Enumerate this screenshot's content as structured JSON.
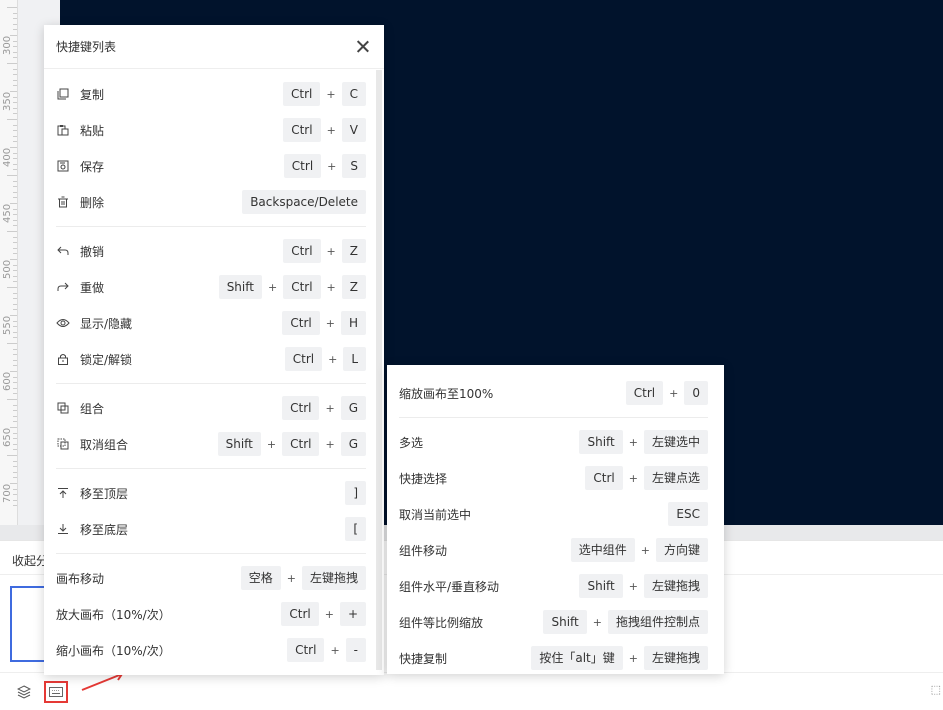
{
  "ruler": {
    "ticks": [
      "300",
      "350",
      "400",
      "450",
      "500",
      "550",
      "600",
      "650",
      "700"
    ]
  },
  "bottom_panel": {
    "tab_label": "收起分"
  },
  "shortcut_panel": {
    "title": "快捷键列表",
    "groups": [
      [
        {
          "icon": "copy-icon",
          "label": "复制",
          "keys": [
            "Ctrl",
            "C"
          ]
        },
        {
          "icon": "paste-icon",
          "label": "粘贴",
          "keys": [
            "Ctrl",
            "V"
          ]
        },
        {
          "icon": "save-icon",
          "label": "保存",
          "keys": [
            "Ctrl",
            "S"
          ]
        },
        {
          "icon": "delete-icon",
          "label": "删除",
          "keys": [
            "Backspace/Delete"
          ]
        }
      ],
      [
        {
          "icon": "undo-icon",
          "label": "撤销",
          "keys": [
            "Ctrl",
            "Z"
          ]
        },
        {
          "icon": "redo-icon",
          "label": "重做",
          "keys": [
            "Shift",
            "Ctrl",
            "Z"
          ]
        },
        {
          "icon": "eye-icon",
          "label": "显示/隐藏",
          "keys": [
            "Ctrl",
            "H"
          ]
        },
        {
          "icon": "lock-icon",
          "label": "锁定/解锁",
          "keys": [
            "Ctrl",
            "L"
          ]
        }
      ],
      [
        {
          "icon": "group-icon",
          "label": "组合",
          "keys": [
            "Ctrl",
            "G"
          ]
        },
        {
          "icon": "ungroup-icon",
          "label": "取消组合",
          "keys": [
            "Shift",
            "Ctrl",
            "G"
          ]
        }
      ],
      [
        {
          "icon": "move-top-icon",
          "label": "移至顶层",
          "keys": [
            "]"
          ]
        },
        {
          "icon": "move-bottom-icon",
          "label": "移至底层",
          "keys": [
            "["
          ]
        }
      ],
      [
        {
          "icon": "",
          "label": "画布移动",
          "keys": [
            "空格",
            "左键拖拽"
          ]
        },
        {
          "icon": "",
          "label": "放大画布（10%/次）",
          "keys": [
            "Ctrl",
            "+"
          ]
        },
        {
          "icon": "",
          "label": "缩小画布（10%/次）",
          "keys": [
            "Ctrl",
            "-"
          ]
        }
      ]
    ]
  },
  "shortcut_panel_2": {
    "groups": [
      [
        {
          "label": "缩放画布至100%",
          "keys": [
            "Ctrl",
            "0"
          ]
        }
      ],
      [
        {
          "label": "多选",
          "keys": [
            "Shift",
            "左键选中"
          ]
        },
        {
          "label": "快捷选择",
          "keys": [
            "Ctrl",
            "左键点选"
          ]
        },
        {
          "label": "取消当前选中",
          "keys": [
            "ESC"
          ]
        },
        {
          "label": "组件移动",
          "keys": [
            "选中组件",
            "方向键"
          ]
        },
        {
          "label": "组件水平/垂直移动",
          "keys": [
            "Shift",
            "左键拖拽"
          ]
        },
        {
          "label": "组件等比例缩放",
          "keys": [
            "Shift",
            "拖拽组件控制点"
          ]
        },
        {
          "label": "快捷复制",
          "keys": [
            "按住「alt」键",
            "左键拖拽"
          ]
        }
      ]
    ]
  },
  "statusbar": {
    "icons": [
      "layers-icon",
      "keyboard-icon"
    ]
  },
  "colors": {
    "canvas": "#01132c",
    "highlight": "#e53935",
    "selection": "#3f6bdf"
  }
}
